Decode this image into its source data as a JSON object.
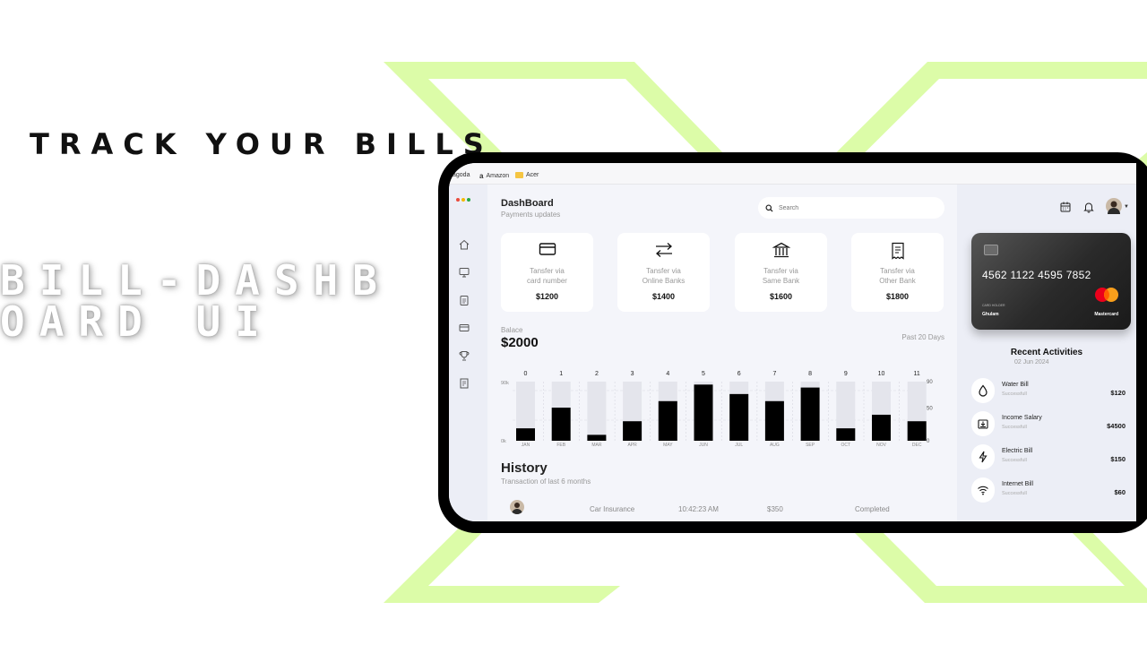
{
  "promo": {
    "headline": "TRACK YOUR BILLS",
    "subheadline": "BILL-DASHBOARD UI"
  },
  "colors": {
    "accent_lime": "#dcfca8",
    "frame": "#000000",
    "panel": "#eceef6",
    "background": "#f4f5fa"
  },
  "bookmarks": [
    {
      "label": "agoda"
    },
    {
      "label": "Amazon",
      "icon": "amazon-icon"
    },
    {
      "label": "Acer",
      "icon": "folder-icon"
    }
  ],
  "sidebar": {
    "items": [
      {
        "icon": "home-icon"
      },
      {
        "icon": "monitor-icon"
      },
      {
        "icon": "clipboard-icon"
      },
      {
        "icon": "card-icon"
      },
      {
        "icon": "trophy-icon"
      },
      {
        "icon": "document-icon"
      }
    ]
  },
  "header": {
    "title": "DashBoard",
    "subtitle": "Payments updates",
    "search_placeholder": "Search"
  },
  "transfers": [
    {
      "icon": "credit-card-icon",
      "line1": "Tansfer via",
      "line2": "card number",
      "amount": "$1200"
    },
    {
      "icon": "transfer-arrows-icon",
      "line1": "Tansfer via",
      "line2": "Online Banks",
      "amount": "$1400"
    },
    {
      "icon": "bank-icon",
      "line1": "Tansfer via",
      "line2": "Same Bank",
      "amount": "$1600"
    },
    {
      "icon": "receipt-icon",
      "line1": "Tansfer via",
      "line2": "Other Bank",
      "amount": "$1800"
    }
  ],
  "balance": {
    "label": "Balace",
    "value": "$2000",
    "period": "Past 20 Days"
  },
  "chart_data": {
    "type": "bar",
    "top_labels": [
      "0",
      "1",
      "2",
      "3",
      "4",
      "5",
      "6",
      "7",
      "8",
      "9",
      "10",
      "11"
    ],
    "categories": [
      "JAN",
      "FEB",
      "MAR",
      "APR",
      "MAY",
      "JUN",
      "JUL",
      "AUG",
      "SEP",
      "OCT",
      "NOV",
      "DEC"
    ],
    "values": [
      21,
      56,
      10,
      33,
      67,
      95,
      79,
      67,
      90,
      21,
      44,
      33
    ],
    "background_max": 100,
    "left_axis_ticks": [
      "90k",
      "0k"
    ],
    "right_axis_ticks": [
      "90",
      "50",
      "0"
    ],
    "colors": {
      "bar": "#000000",
      "track": "#e4e5ec"
    }
  },
  "history": {
    "title": "History",
    "subtitle": "Transaction of last 6 months",
    "rows": [
      {
        "name": "Car Insurance",
        "time": "10:42:23 AM",
        "amount": "$350",
        "status": "Completed"
      }
    ]
  },
  "topbar": {
    "icons": [
      "calendar-icon",
      "bell-icon",
      "profile-avatar"
    ]
  },
  "credit_card": {
    "number": "4562 1122 4595 7852",
    "holder_label": "CARD HOLDER",
    "holder_name": "Ghulam",
    "brand": "Mastercard"
  },
  "recent": {
    "title": "Recent Activities",
    "date": "02 Jun 2024",
    "items": [
      {
        "icon": "water-drop-icon",
        "name": "Water Bill",
        "status": "Successfull",
        "amount": "$120"
      },
      {
        "icon": "income-icon",
        "name": "Income Salary",
        "status": "Successfull",
        "amount": "$4500"
      },
      {
        "icon": "lightning-icon",
        "name": "Electric Bill",
        "status": "Successfull",
        "amount": "$150"
      },
      {
        "icon": "wifi-icon",
        "name": "Internet Bill",
        "status": "Successfull",
        "amount": "$60"
      }
    ]
  }
}
